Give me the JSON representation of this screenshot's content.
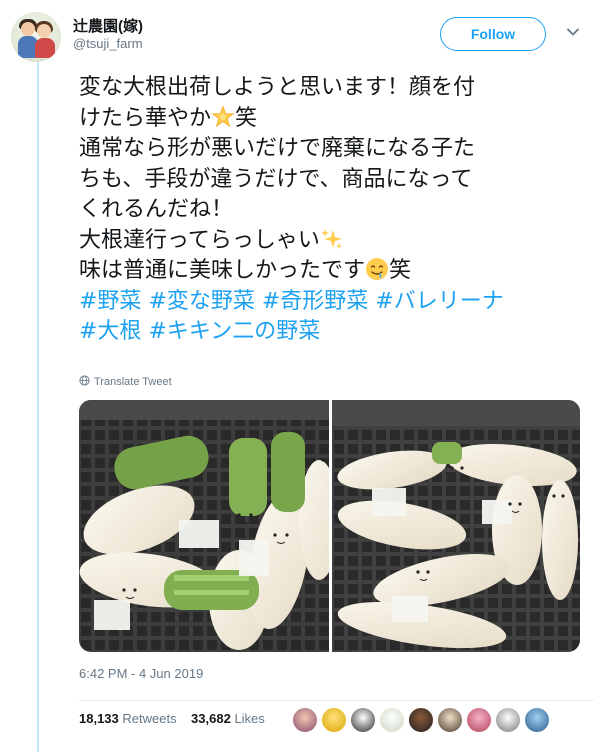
{
  "user": {
    "name": "辻農園(嫁)",
    "handle": "@tsuji_farm",
    "avatar": "avatar-couple-illustration"
  },
  "header": {
    "follow_label": "Follow",
    "menu_icon": "chevron-down-icon"
  },
  "tweet": {
    "lines": [
      [
        "変な大根出荷しようと思います！顔を付"
      ],
      [
        "けたら華やか",
        "[star-emoji]",
        "笑"
      ],
      [
        "通常なら形が悪いだけで廃棄になる子た"
      ],
      [
        "ちも、手段が違うだけで、商品になって"
      ],
      [
        "くれるんだね！"
      ],
      [
        "大根達行ってらっしゃい",
        "[sparkles-emoji]"
      ],
      [
        "味は普通に美味しかったです",
        "[drooling-face-emoji]",
        "笑"
      ]
    ],
    "hashtags": [
      "#野菜",
      "#変な野菜",
      "#奇形野菜",
      "#バレリーナ",
      "#大根",
      "#キキン二の野菜"
    ]
  },
  "translate_label": "Translate Tweet",
  "media": {
    "photos": [
      {
        "description": "daikon-radishes-with-faces-in-crate-left"
      },
      {
        "description": "daikon-radishes-with-faces-in-crate-right"
      }
    ]
  },
  "timestamp": "6:42 PM - 4 Jun 2019",
  "stats": {
    "retweets_count": "18,133",
    "retweets_label": "Retweets",
    "likes_count": "33,682",
    "likes_label": "Likes"
  },
  "colors": {
    "link": "#1da1f2",
    "text": "#14171a",
    "muted": "#657786",
    "thread": "#c4e7fb"
  }
}
